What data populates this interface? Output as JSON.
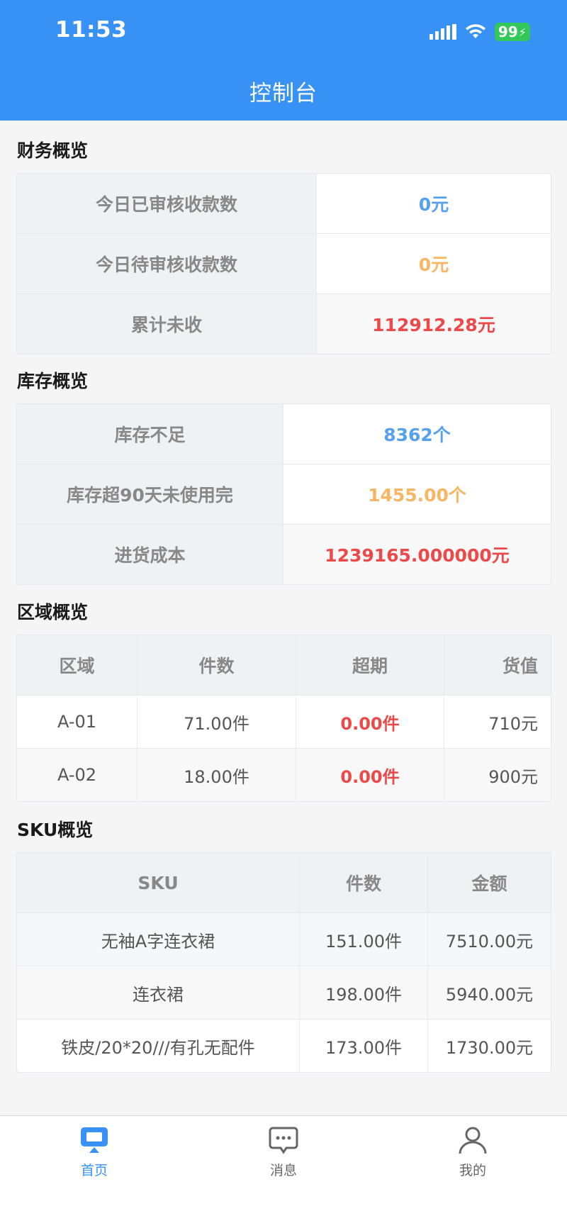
{
  "status_bar": {
    "time": "11:53",
    "battery": "99"
  },
  "header": {
    "title": "控制台"
  },
  "finance": {
    "title": "财务概览",
    "rows": [
      {
        "label": "今日已审核收款数",
        "value": "0元",
        "color": "#55a1ee"
      },
      {
        "label": "今日待审核收款数",
        "value": "0元",
        "color": "#f8b563"
      },
      {
        "label": "累计未收",
        "value": "112912.28元",
        "color": "#ee4949"
      }
    ]
  },
  "inventory": {
    "title": "库存概览",
    "rows": [
      {
        "label": "库存不足",
        "value": "8362个",
        "color": "#55a1ee"
      },
      {
        "label": "库存超90天未使用完",
        "value": "1455.00个",
        "color": "#f8b563"
      },
      {
        "label": "进货成本",
        "value": "1239165.000000元",
        "color": "#ee4949"
      }
    ]
  },
  "region": {
    "title": "区域概览",
    "headers": [
      "区域",
      "件数",
      "超期",
      "货值"
    ],
    "rows": [
      [
        "A-01",
        "71.00件",
        "0.00件",
        "710元"
      ],
      [
        "A-02",
        "18.00件",
        "0.00件",
        "900元"
      ]
    ]
  },
  "sku": {
    "title": "SKU概览",
    "headers": [
      "SKU",
      "件数",
      "金额"
    ],
    "rows": [
      [
        "无袖A字连衣裙",
        "151.00件",
        "7510.00元"
      ],
      [
        "连衣裙",
        "198.00件",
        "5940.00元"
      ],
      [
        "铁皮/20*20///有孔无配件",
        "173.00件",
        "1730.00元"
      ]
    ]
  },
  "tabbar": {
    "items": [
      {
        "label": "首页",
        "icon": "monitor-icon",
        "active": true
      },
      {
        "label": "消息",
        "icon": "chat-bubble-icon",
        "active": false
      },
      {
        "label": "我的",
        "icon": "user-icon",
        "active": false
      }
    ]
  },
  "colors": {
    "primary": "#3891f5",
    "blue": "#55a1ee",
    "orange": "#f8b563",
    "red": "#ee4949"
  }
}
